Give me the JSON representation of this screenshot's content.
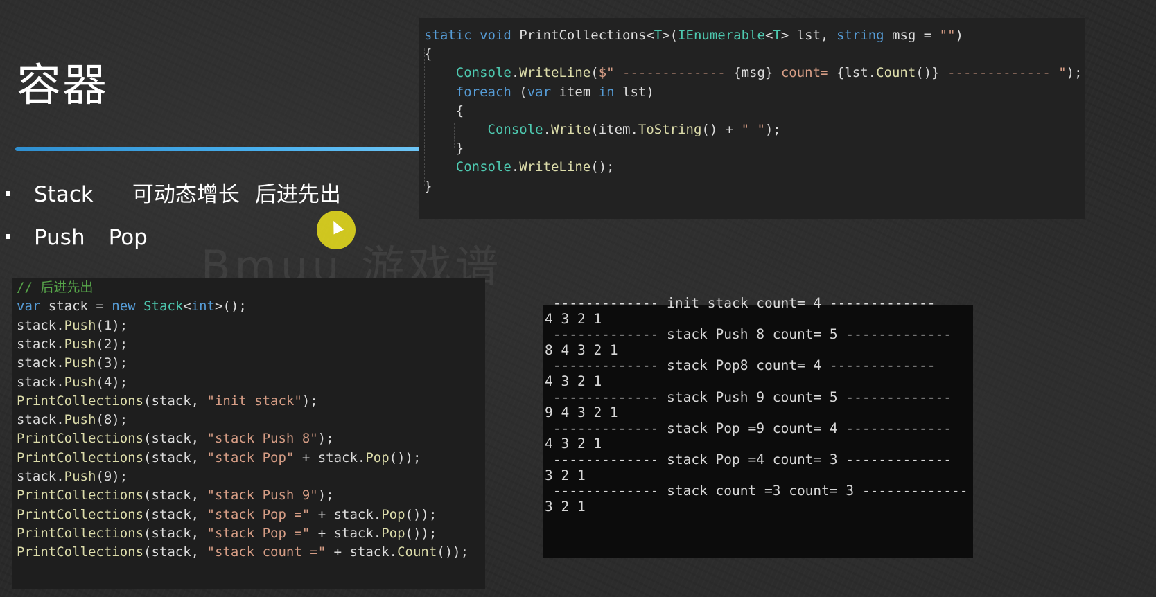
{
  "slide": {
    "title": "容器",
    "bullets": [
      {
        "term": "Stack",
        "desc1": "可动态增长",
        "desc2": "后进先出"
      },
      {
        "term": "Push",
        "desc1": "Pop"
      }
    ],
    "watermark": "Bmuu 游戏谱"
  },
  "colors": {
    "accent_rule": "#49b0ee",
    "keyword": "#569cd6",
    "type": "#4ec9b0",
    "string": "#d69d85",
    "comment": "#57a64a",
    "cursor_highlight": "#e1d71e"
  },
  "code_top": {
    "lines": [
      [
        {
          "c": "kw",
          "t": "static"
        },
        {
          "c": "",
          "t": " "
        },
        {
          "c": "kw",
          "t": "void"
        },
        {
          "c": "",
          "t": " PrintCollections<"
        },
        {
          "c": "ty",
          "t": "T"
        },
        {
          "c": "",
          "t": ">("
        },
        {
          "c": "ty",
          "t": "IEnumerable"
        },
        {
          "c": "",
          "t": "<"
        },
        {
          "c": "ty",
          "t": "T"
        },
        {
          "c": "",
          "t": "> lst, "
        },
        {
          "c": "kw",
          "t": "string"
        },
        {
          "c": "",
          "t": " msg = "
        },
        {
          "c": "str",
          "t": "\"\""
        },
        {
          "c": "",
          "t": ")"
        }
      ],
      [
        {
          "c": "",
          "t": "{"
        }
      ],
      [
        {
          "c": "",
          "t": "    "
        },
        {
          "c": "ty",
          "t": "Console"
        },
        {
          "c": "",
          "t": "."
        },
        {
          "c": "fn",
          "t": "WriteLine"
        },
        {
          "c": "",
          "t": "("
        },
        {
          "c": "str",
          "t": "$\" ------------- "
        },
        {
          "c": "",
          "t": "{msg}"
        },
        {
          "c": "str",
          "t": " count= "
        },
        {
          "c": "",
          "t": "{lst."
        },
        {
          "c": "fn",
          "t": "Count"
        },
        {
          "c": "",
          "t": "()}"
        },
        {
          "c": "str",
          "t": " ------------- \""
        },
        {
          "c": "",
          "t": ");"
        }
      ],
      [
        {
          "c": "",
          "t": "    "
        },
        {
          "c": "kw",
          "t": "foreach"
        },
        {
          "c": "",
          "t": " ("
        },
        {
          "c": "kw",
          "t": "var"
        },
        {
          "c": "",
          "t": " item "
        },
        {
          "c": "kw",
          "t": "in"
        },
        {
          "c": "",
          "t": " lst)"
        }
      ],
      [
        {
          "c": "",
          "t": "    {"
        }
      ],
      [
        {
          "c": "",
          "t": "        "
        },
        {
          "c": "ty",
          "t": "Console"
        },
        {
          "c": "",
          "t": "."
        },
        {
          "c": "fn",
          "t": "Write"
        },
        {
          "c": "",
          "t": "(item."
        },
        {
          "c": "fn",
          "t": "ToString"
        },
        {
          "c": "",
          "t": "() + "
        },
        {
          "c": "str",
          "t": "\" \""
        },
        {
          "c": "",
          "t": ");"
        }
      ],
      [
        {
          "c": "",
          "t": "    }"
        }
      ],
      [
        {
          "c": "",
          "t": "    "
        },
        {
          "c": "ty",
          "t": "Console"
        },
        {
          "c": "",
          "t": "."
        },
        {
          "c": "fn",
          "t": "WriteLine"
        },
        {
          "c": "",
          "t": "();"
        }
      ],
      [
        {
          "c": "",
          "t": "}"
        }
      ]
    ]
  },
  "code_bottom": {
    "lines": [
      [
        {
          "c": "cm",
          "t": "// 后进先出"
        }
      ],
      [
        {
          "c": "kw",
          "t": "var"
        },
        {
          "c": "",
          "t": " stack = "
        },
        {
          "c": "kw",
          "t": "new"
        },
        {
          "c": "",
          "t": " "
        },
        {
          "c": "ty",
          "t": "Stack"
        },
        {
          "c": "",
          "t": "<"
        },
        {
          "c": "kw",
          "t": "int"
        },
        {
          "c": "",
          "t": ">();"
        }
      ],
      [
        {
          "c": "",
          "t": "stack."
        },
        {
          "c": "fn",
          "t": "Push"
        },
        {
          "c": "",
          "t": "(1);"
        }
      ],
      [
        {
          "c": "",
          "t": "stack."
        },
        {
          "c": "fn",
          "t": "Push"
        },
        {
          "c": "",
          "t": "(2);"
        }
      ],
      [
        {
          "c": "",
          "t": "stack."
        },
        {
          "c": "fn",
          "t": "Push"
        },
        {
          "c": "",
          "t": "(3);"
        }
      ],
      [
        {
          "c": "",
          "t": "stack."
        },
        {
          "c": "fn",
          "t": "Push"
        },
        {
          "c": "",
          "t": "(4);"
        }
      ],
      [
        {
          "c": "fn",
          "t": "PrintCollections"
        },
        {
          "c": "",
          "t": "(stack, "
        },
        {
          "c": "str",
          "t": "\"init stack\""
        },
        {
          "c": "",
          "t": ");"
        }
      ],
      [
        {
          "c": "",
          "t": "stack."
        },
        {
          "c": "fn",
          "t": "Push"
        },
        {
          "c": "",
          "t": "(8);"
        }
      ],
      [
        {
          "c": "fn",
          "t": "PrintCollections"
        },
        {
          "c": "",
          "t": "(stack, "
        },
        {
          "c": "str",
          "t": "\"stack Push 8\""
        },
        {
          "c": "",
          "t": ");"
        }
      ],
      [
        {
          "c": "fn",
          "t": "PrintCollections"
        },
        {
          "c": "",
          "t": "(stack, "
        },
        {
          "c": "str",
          "t": "\"stack Pop\""
        },
        {
          "c": "",
          "t": " + stack."
        },
        {
          "c": "fn",
          "t": "Pop"
        },
        {
          "c": "",
          "t": "());"
        }
      ],
      [
        {
          "c": "",
          "t": "stack."
        },
        {
          "c": "fn",
          "t": "Push"
        },
        {
          "c": "",
          "t": "(9);"
        }
      ],
      [
        {
          "c": "fn",
          "t": "PrintCollections"
        },
        {
          "c": "",
          "t": "(stack, "
        },
        {
          "c": "str",
          "t": "\"stack Push 9\""
        },
        {
          "c": "",
          "t": ");"
        }
      ],
      [
        {
          "c": "fn",
          "t": "PrintCollections"
        },
        {
          "c": "",
          "t": "(stack, "
        },
        {
          "c": "str",
          "t": "\"stack Pop =\""
        },
        {
          "c": "",
          "t": " + stack."
        },
        {
          "c": "fn",
          "t": "Pop"
        },
        {
          "c": "",
          "t": "());"
        }
      ],
      [
        {
          "c": "fn",
          "t": "PrintCollections"
        },
        {
          "c": "",
          "t": "(stack, "
        },
        {
          "c": "str",
          "t": "\"stack Pop =\""
        },
        {
          "c": "",
          "t": " + stack."
        },
        {
          "c": "fn",
          "t": "Pop"
        },
        {
          "c": "",
          "t": "());"
        }
      ],
      [
        {
          "c": "fn",
          "t": "PrintCollections"
        },
        {
          "c": "",
          "t": "(stack, "
        },
        {
          "c": "str",
          "t": "\"stack count =\""
        },
        {
          "c": "",
          "t": " + stack."
        },
        {
          "c": "fn",
          "t": "Count"
        },
        {
          "c": "",
          "t": "());"
        }
      ]
    ]
  },
  "console": {
    "lines": [
      " ------------- init stack count= 4 -------------",
      "4 3 2 1",
      " ------------- stack Push 8 count= 5 -------------",
      "8 4 3 2 1",
      " ------------- stack Pop8 count= 4 -------------",
      "4 3 2 1",
      " ------------- stack Push 9 count= 5 -------------",
      "9 4 3 2 1",
      " ------------- stack Pop =9 count= 4 -------------",
      "4 3 2 1",
      " ------------- stack Pop =4 count= 3 -------------",
      "3 2 1",
      " ------------- stack count =3 count= 3 -------------",
      "3 2 1"
    ]
  }
}
